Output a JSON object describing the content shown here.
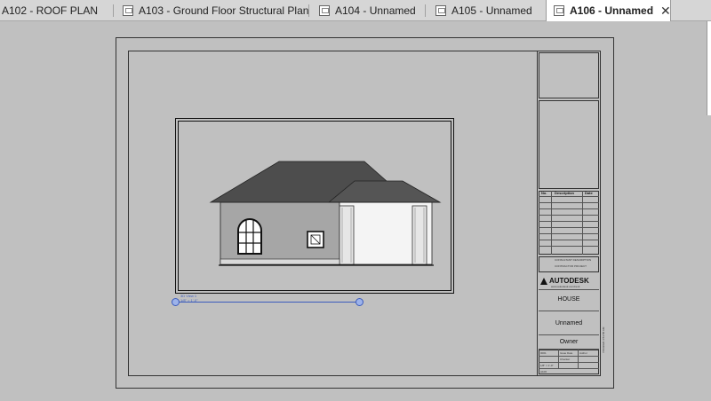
{
  "tabs": [
    {
      "label": "A102 - ROOF PLAN",
      "active": false,
      "icon": "sheet-icon"
    },
    {
      "label": "A103 - Ground Floor Structural Plan",
      "active": false,
      "icon": "sheet-icon"
    },
    {
      "label": "A104 - Unnamed",
      "active": false,
      "icon": "sheet-icon"
    },
    {
      "label": "A105 - Unnamed",
      "active": false,
      "icon": "sheet-icon"
    },
    {
      "label": "A106 - Unnamed",
      "active": true,
      "icon": "sheet-icon"
    }
  ],
  "close_glyph": "✕",
  "title_block": {
    "revision_headers": {
      "no": "No.",
      "description": "Description",
      "date": "Date"
    },
    "consultant_lines": [
      "CONSULTANT DESCRIPTION",
      "CONTRACTOR PROJECT"
    ],
    "logo": "AUTODESK",
    "logo_sub": "www.autodesk.com/revit",
    "project_name": "HOUSE",
    "sheet_name": "Unnamed",
    "owner": "Owner",
    "fields": {
      "project_number_label": "Project number",
      "project_number": "0001",
      "date_label": "Date",
      "date": "Issue Date",
      "drawn_by_label": "Drawn by",
      "drawn_by": "Author",
      "checked_by_label": "Checked by",
      "checked_by": "Checker",
      "scale": "1/8\" = 1'-0\"",
      "sheet_number": "A106"
    },
    "vertical_text": "7/26/2020 4:53:58 AM"
  },
  "view_title": {
    "name": "3D View 1",
    "scale": "1/8\" = 1'-0\""
  },
  "colors": {
    "tab_active_bg": "#ffffff",
    "canvas_bg": "#c0c0c0",
    "selection_blue": "#3b5bbd",
    "roof": "#4d4d4d",
    "wall": "#a6a6a6"
  }
}
